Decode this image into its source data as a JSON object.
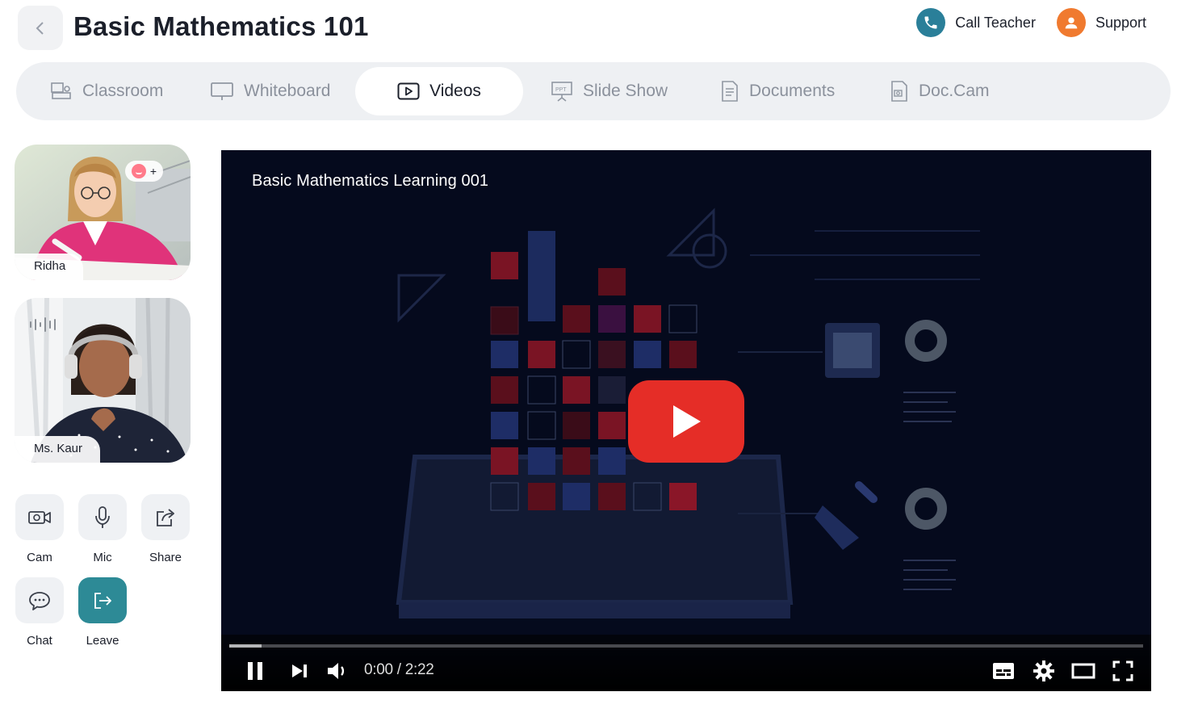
{
  "header": {
    "title": "Basic Mathematics 101",
    "back_icon": "chevron-left-icon",
    "call_teacher_label": "Call Teacher",
    "support_label": "Support",
    "call_color": "#2a7f99",
    "support_color": "#f07a2f"
  },
  "tabs": [
    {
      "label": "Classroom",
      "icon": "classroom-icon"
    },
    {
      "label": "Whiteboard",
      "icon": "whiteboard-icon"
    },
    {
      "label": "Videos",
      "icon": "video-icon",
      "active": true
    },
    {
      "label": "Slide Show",
      "icon": "slideshow-icon"
    },
    {
      "label": "Documents",
      "icon": "document-icon"
    },
    {
      "label": "Doc.Cam",
      "icon": "doccam-icon"
    }
  ],
  "participants": [
    {
      "name": "Ridha",
      "reaction": "+"
    },
    {
      "name": "Ms. Kaur"
    }
  ],
  "controls": {
    "cam": "Cam",
    "mic": "Mic",
    "share": "Share",
    "chat": "Chat",
    "leave": "Leave",
    "leave_color": "#2d8a96"
  },
  "video": {
    "title": "Basic Mathematics Learning 001",
    "time": "0:00 / 2:22",
    "progress": 0.035,
    "play_color": "#e52d27"
  }
}
